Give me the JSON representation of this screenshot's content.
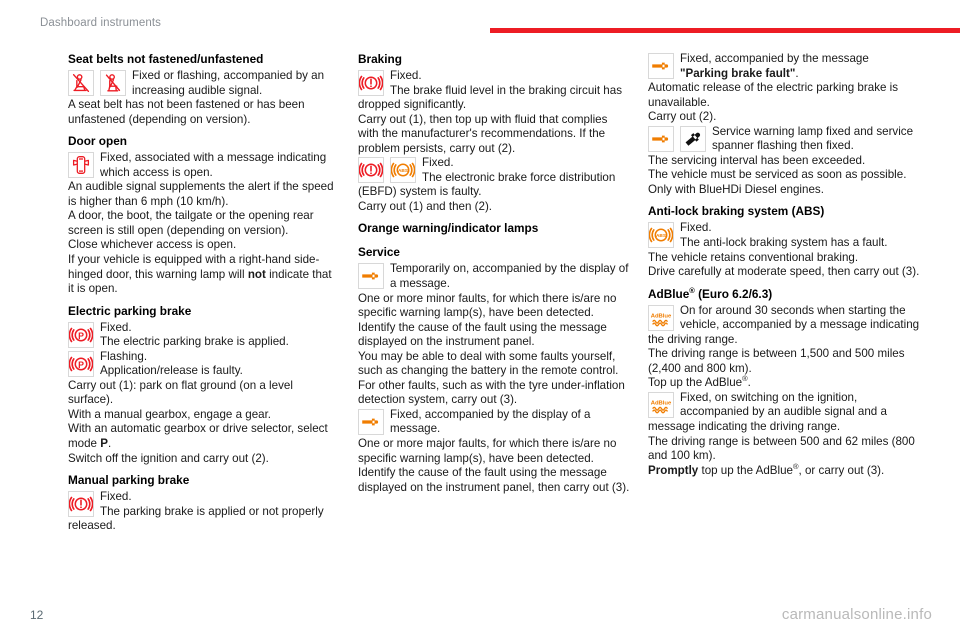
{
  "header": {
    "title": "Dashboard instruments",
    "rule_color": "#ed1c24"
  },
  "footer": {
    "page_number": "12",
    "watermark": "carmanualsonline.info"
  },
  "columns": {
    "left": {
      "sections": [
        {
          "heading": "Seat belts not fastened/unfastened",
          "icons": [
            "seatbelt-front-warning-icon",
            "seatbelt-rear-warning-icon"
          ],
          "lead": "Fixed or flashing, accompanied by an increasing audible signal.",
          "body": [
            "A seat belt has not been fastened or has been unfastened (depending on version)."
          ]
        },
        {
          "heading": "Door open",
          "icons": [
            "door-open-warning-icon"
          ],
          "lead": "Fixed, associated with a message indicating which access is open.",
          "body": [
            "An audible signal supplements the alert if the speed is higher than 6 mph (10 km/h).",
            "A door, the boot, the tailgate or the opening rear screen is still open (depending on version).",
            "Close whichever access is open.",
            "If your vehicle is equipped with a right-hand side-hinged door, this warning lamp will not indicate that it is open."
          ]
        },
        {
          "heading": "Electric parking brake",
          "entries": [
            {
              "icons": [
                "electric-parking-brake-icon"
              ],
              "lead": "Fixed.",
              "lead2": "The electric parking brake is applied."
            },
            {
              "icons": [
                "electric-parking-brake-icon"
              ],
              "lead": "Flashing.",
              "lead2": "Application/release is faulty."
            }
          ],
          "body": [
            "Carry out (1): park on flat ground (on a level surface).",
            "With a manual gearbox, engage a gear.",
            "With an automatic gearbox or drive selector, select mode P.",
            "Switch off the ignition and carry out (2)."
          ]
        },
        {
          "heading": "Manual parking brake",
          "icons": [
            "brake-warning-icon"
          ],
          "lead": "Fixed.",
          "lead2": "The parking brake is applied or not properly released."
        }
      ]
    },
    "middle": {
      "sections": [
        {
          "heading": "Braking",
          "icons": [
            "brake-warning-icon"
          ],
          "lead": "Fixed.",
          "lead2": "The brake fluid level in the braking circuit has dropped significantly.",
          "body": [
            "Carry out (1), then top up with fluid that complies with the manufacturer's recommendations. If the problem persists, carry out (2)."
          ]
        },
        {
          "icons": [
            "brake-warning-icon",
            "abs-warning-icon"
          ],
          "lead": "Fixed.",
          "lead2": "The electronic brake force distribution (EBFD) system is faulty.",
          "body": [
            "Carry out (1) and then (2)."
          ]
        },
        {
          "heading": "Orange warning/indicator lamps"
        },
        {
          "heading": "Service",
          "icons": [
            "service-spanner-orange-icon"
          ],
          "lead": "Temporarily on, accompanied by the display of a message.",
          "body": [
            "One or more minor faults, for which there is/are no specific warning lamp(s), have been detected.",
            "Identify the cause of the fault using the message displayed on the instrument panel.",
            "You may be able to deal with some faults yourself, such as changing the battery in the remote control.",
            "For other faults, such as with the tyre under-inflation detection system, carry out (3)."
          ]
        },
        {
          "icons": [
            "service-spanner-orange-icon"
          ],
          "lead": "Fixed, accompanied by the display of a message.",
          "body": [
            "One or more major faults, for which there is/are no specific warning lamp(s), have been detected.",
            "Identify the cause of the fault using the message displayed on the instrument panel, then carry out (3)."
          ]
        }
      ]
    },
    "right": {
      "sections": [
        {
          "icons": [
            "service-spanner-orange-icon"
          ],
          "lead": "Fixed, accompanied by the message",
          "lead_bold": "\"Parking brake fault\"",
          "lead_tail": ".",
          "body": [
            "Automatic release of the electric parking brake is unavailable.",
            "Carry out (2)."
          ]
        },
        {
          "icons": [
            "service-spanner-orange-icon",
            "service-spanner-black-icon"
          ],
          "lead": "Service warning lamp fixed and service spanner flashing then fixed.",
          "body": [
            "The servicing interval has been exceeded.",
            "The vehicle must be serviced as soon as possible.",
            "Only with BlueHDi Diesel engines."
          ]
        },
        {
          "heading": "Anti-lock braking system (ABS)",
          "icons": [
            "abs-warning-icon"
          ],
          "lead": "Fixed.",
          "lead2": "The anti-lock braking system has a fault.",
          "body": [
            "The vehicle retains conventional braking.",
            "Drive carefully at moderate speed, then carry out (3)."
          ]
        },
        {
          "heading": "AdBlue® (Euro 6.2/6.3)",
          "icons": [
            "adblue-warning-icon"
          ],
          "lead": "On for around 30 seconds when starting the vehicle, accompanied by a message indicating the driving range.",
          "body": [
            "The driving range is between 1,500 and 500 miles (2,400 and 800 km).",
            "Top up the AdBlue®."
          ]
        },
        {
          "icons": [
            "adblue-warning-icon"
          ],
          "lead": "Fixed, on switching on the ignition, accompanied by an audible signal and a message indicating the driving range.",
          "body": [
            "The driving range is between 500 and 62 miles (800 and 100 km).",
            "Promptly top up the AdBlue®, or carry out (3)."
          ]
        }
      ]
    }
  },
  "colors": {
    "red_warning": "#ed1c24",
    "orange_warning": "#f07d00",
    "header_rule": "#ed1c24",
    "header_text": "#8b9096"
  }
}
